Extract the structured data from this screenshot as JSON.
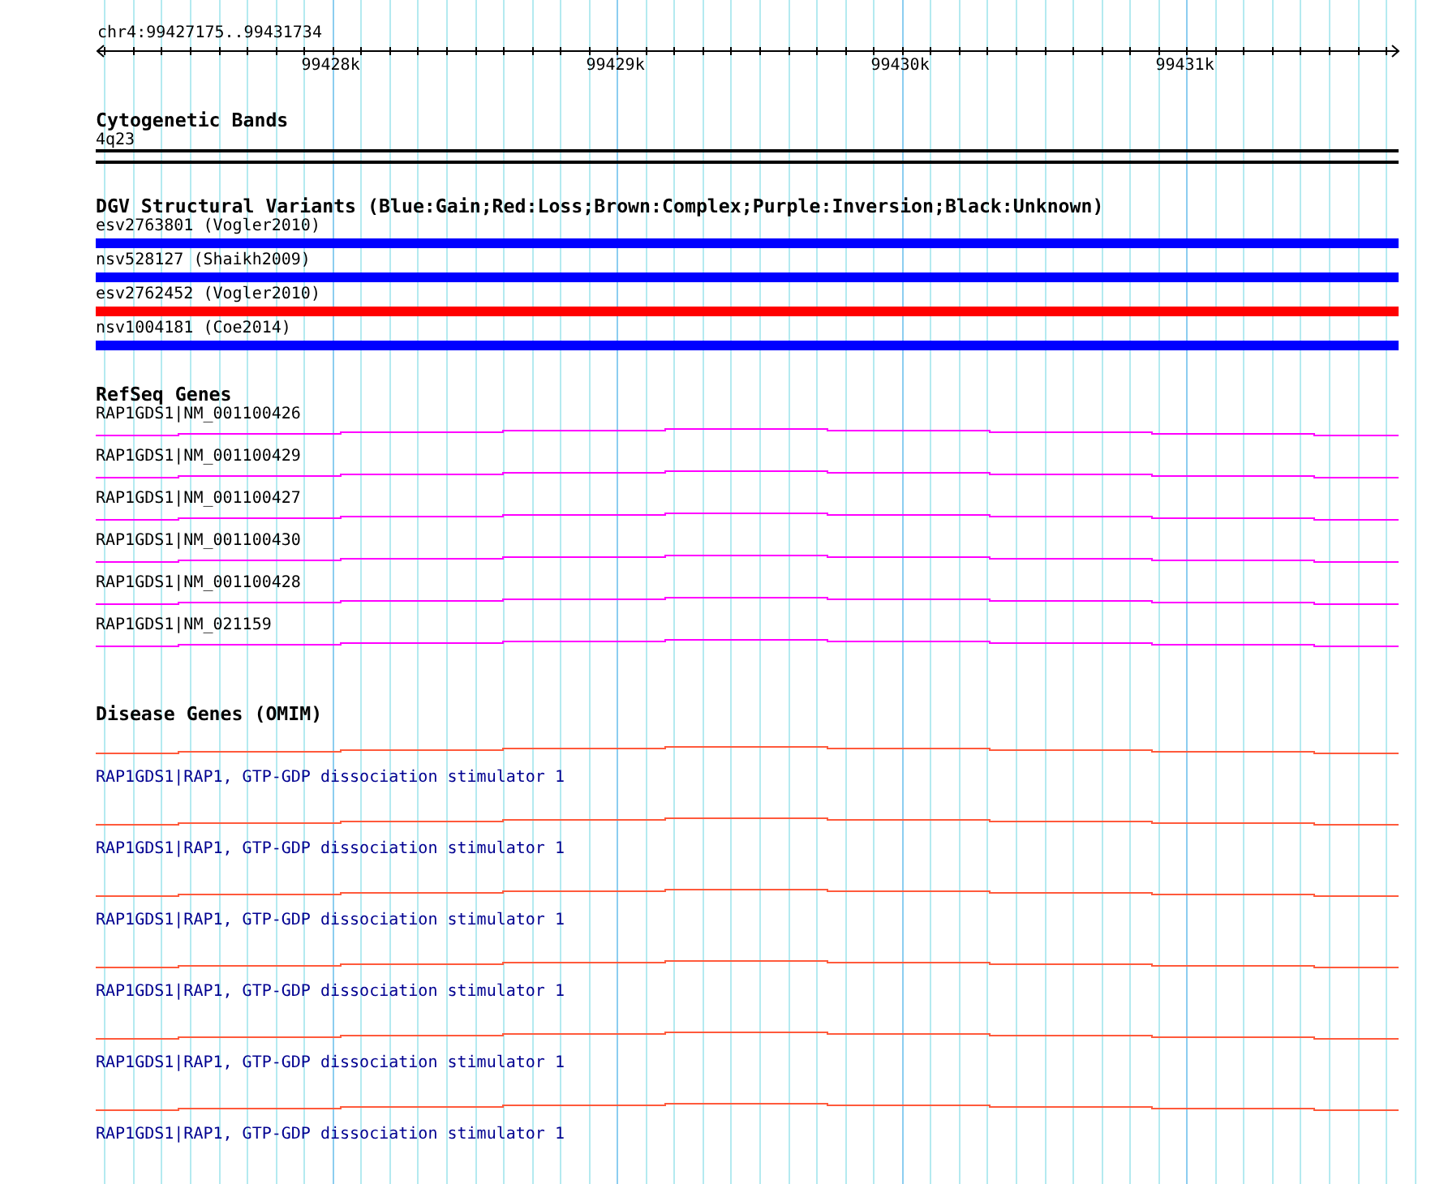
{
  "ruler": {
    "range": "chr4:99427175..99431734",
    "ticks": [
      "99428k",
      "99429k",
      "99430k",
      "99431k"
    ]
  },
  "tracks": [
    {
      "kind": "bands",
      "title": "Cytogenetic Bands",
      "items": [
        {
          "label": "4q23"
        }
      ]
    },
    {
      "kind": "variants",
      "title": "DGV Structural Variants (Blue:Gain;Red:Loss;Brown:Complex;Purple:Inversion;Black:Unknown)",
      "items": [
        {
          "label": "esv2763801 (Vogler2010)",
          "color": "#0000ff"
        },
        {
          "label": "nsv528127 (Shaikh2009)",
          "color": "#0000ff"
        },
        {
          "label": "esv2762452 (Vogler2010)",
          "color": "#ff0000"
        },
        {
          "label": "nsv1004181 (Coe2014)",
          "color": "#0000ff"
        }
      ]
    },
    {
      "kind": "genes",
      "title": "RefSeq Genes",
      "items": [
        {
          "label": "RAP1GDS1|NM_001100426"
        },
        {
          "label": "RAP1GDS1|NM_001100429"
        },
        {
          "label": "RAP1GDS1|NM_001100427"
        },
        {
          "label": "RAP1GDS1|NM_001100430"
        },
        {
          "label": "RAP1GDS1|NM_001100428"
        },
        {
          "label": "RAP1GDS1|NM_021159"
        }
      ]
    },
    {
      "kind": "disease",
      "title": "Disease Genes (OMIM)",
      "items": [
        {
          "label": "RAP1GDS1|RAP1, GTP-GDP dissociation stimulator 1"
        },
        {
          "label": "RAP1GDS1|RAP1, GTP-GDP dissociation stimulator 1"
        },
        {
          "label": "RAP1GDS1|RAP1, GTP-GDP dissociation stimulator 1"
        },
        {
          "label": "RAP1GDS1|RAP1, GTP-GDP dissociation stimulator 1"
        },
        {
          "label": "RAP1GDS1|RAP1, GTP-GDP dissociation stimulator 1"
        },
        {
          "label": "RAP1GDS1|RAP1, GTP-GDP dissociation stimulator 1"
        }
      ]
    }
  ]
}
